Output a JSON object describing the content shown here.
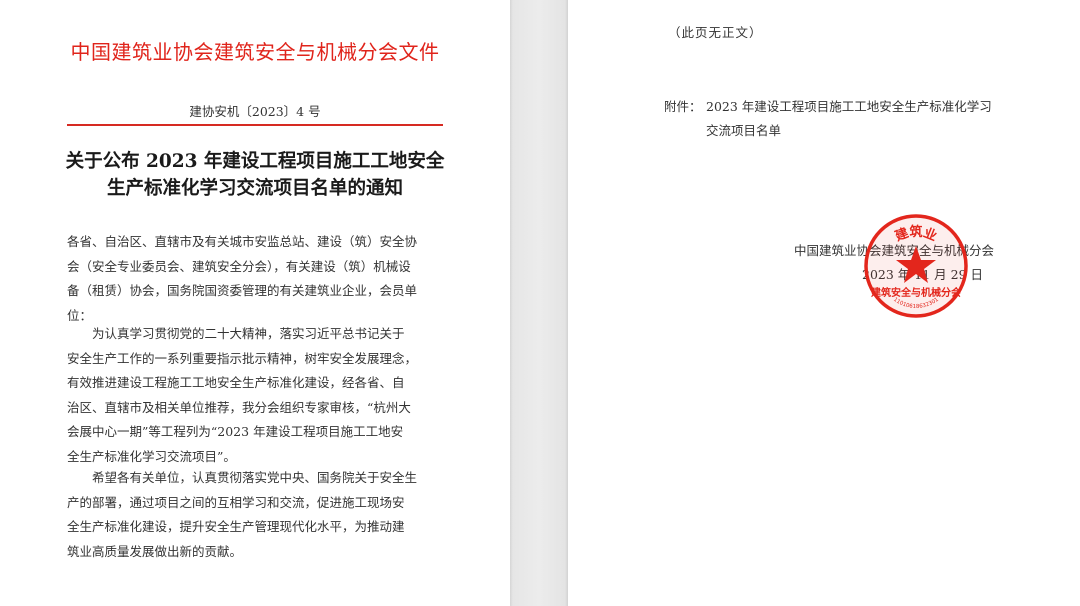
{
  "left_page": {
    "header": "中国建筑业协会建筑安全与机械分会文件",
    "doc_number": "建协安机〔2023〕4 号",
    "title_line1": "关于公布 2023 年建设工程项目施工工地安全",
    "title_line2": "生产标准化学习交流项目名单的通知",
    "addressee_lines": [
      "各省、自治区、直辖市及有关城市安监总站、建设（筑）安全协",
      "会（安全专业委员会、建筑安全分会），有关建设（筑）机械设",
      "备（租赁）协会，国务院国资委管理的有关建筑业企业，会员单",
      "位："
    ],
    "paragraph1_lines": [
      "为认真学习贯彻党的二十大精神，落实习近平总书记关于",
      "安全生产工作的一系列重要指示批示精神，树牢安全发展理念，",
      "有效推进建设工程施工工地安全生产标准化建设，经各省、自",
      "治区、直辖市及相关单位推荐，我分会组织专家审核，“杭州大",
      "会展中心一期”等工程列为“2023 年建设工程项目施工工地安",
      "全生产标准化学习交流项目”。"
    ],
    "paragraph2_lines": [
      "希望各有关单位，认真贯彻落实党中央、国务院关于安全生",
      "产的部署，通过项目之间的互相学习和交流，促进施工现场安",
      "全生产标准化建设，提升安全生产管理现代化水平，为推动建",
      "筑业高质量发展做出新的贡献。"
    ]
  },
  "right_page": {
    "not_body_note": "（此页无正文）",
    "attachment_label": "附件：",
    "attachment_line1": "2023 年建设工程项目施工工地安全生产标准化学习",
    "attachment_line2": "交流项目名单",
    "issuer": "中国建筑业协会建筑安全与机械分会",
    "date": "2023 年 11 月 29 日",
    "seal": {
      "top_text": "建筑业",
      "bottom_text": "建筑安全与机械分会",
      "code": "11010618632301",
      "color": "#e3261c"
    }
  },
  "colors": {
    "header_red": "#e0241b",
    "seal_red": "#e3261c",
    "gap_gray": "#e6e6e6"
  }
}
